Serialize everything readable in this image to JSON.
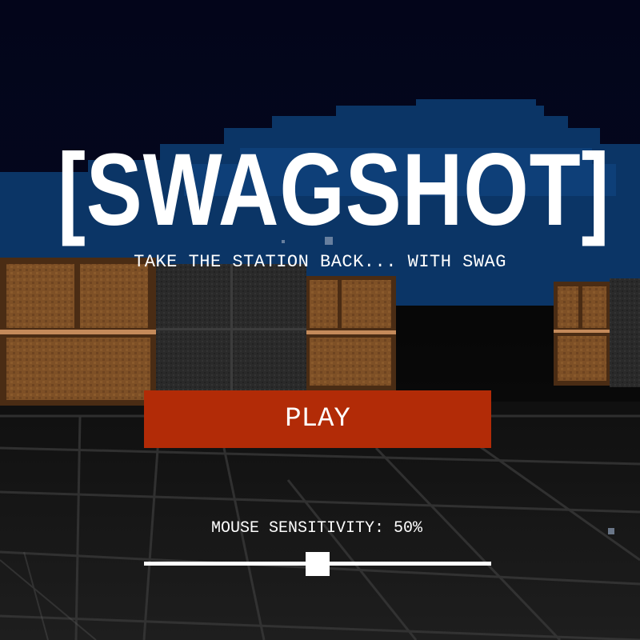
{
  "game": {
    "title": "[SWAGSHOT]",
    "tagline": "TAKE THE STATION BACK... WITH SWAG"
  },
  "menu": {
    "play_label": "PLAY",
    "sensitivity_label": "MOUSE SENSITIVITY: 50%",
    "sensitivity_value": 0.5
  },
  "colors": {
    "sky_top": "#04061a",
    "sky_band": "#0b3566",
    "floor": "#141414",
    "crate": "#7a4a22",
    "play_button": "#b22b07",
    "text": "#ffffff"
  }
}
